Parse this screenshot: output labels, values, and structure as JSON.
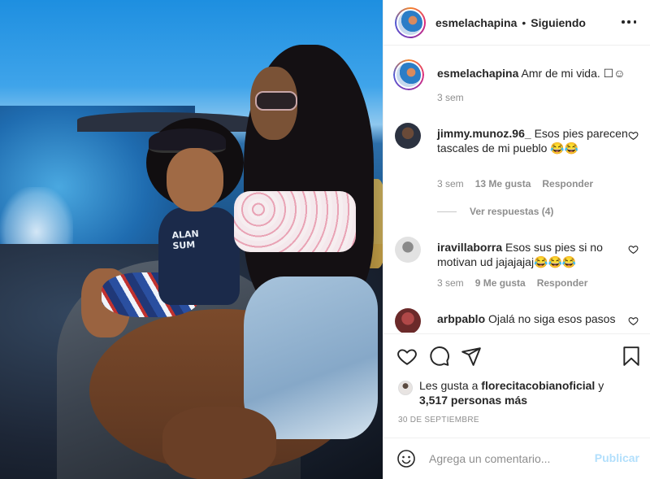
{
  "header": {
    "username": "esmelachapina",
    "separator": "•",
    "follow_status": "Siguiendo",
    "more_icon": "more-horizontal-icon"
  },
  "caption": {
    "username": "esmelachapina",
    "text": "Amr de mi vida. ☐☺",
    "time": "3 sem"
  },
  "comments": [
    {
      "username": "jimmy.munoz.96_",
      "text": "Esos pies parecen tascales de mi pueblo 😂😂",
      "time": "3 sem",
      "likes": "13 Me gusta",
      "reply": "Responder",
      "view_replies": "Ver respuestas (4)"
    },
    {
      "username": "iravillaborra",
      "text": "Esos sus pies si no motivan ud jajajajaj😂😂😂",
      "time": "3 sem",
      "likes": "9 Me gusta",
      "reply": "Responder"
    },
    {
      "username": "arbpablo",
      "text": "Ojalá no siga esos pasos"
    }
  ],
  "actions": {
    "like_icon": "heart-icon",
    "comment_icon": "comment-icon",
    "share_icon": "send-icon",
    "save_icon": "bookmark-icon"
  },
  "likes": {
    "prefix": "Les gusta a",
    "user": "florecitacobianoficial",
    "joiner": "y",
    "others": "3,517 personas más"
  },
  "date": "30 DE SEPTIEMBRE",
  "composer": {
    "placeholder": "Agrega un comentario...",
    "publish_label": "Publicar"
  },
  "photo": {
    "shirt_text": "ALAN\nSUM"
  },
  "colors": {
    "text": "#262626",
    "muted": "#8e8e8e",
    "publish_disabled": "#b2dffc",
    "divider": "#efefef"
  }
}
